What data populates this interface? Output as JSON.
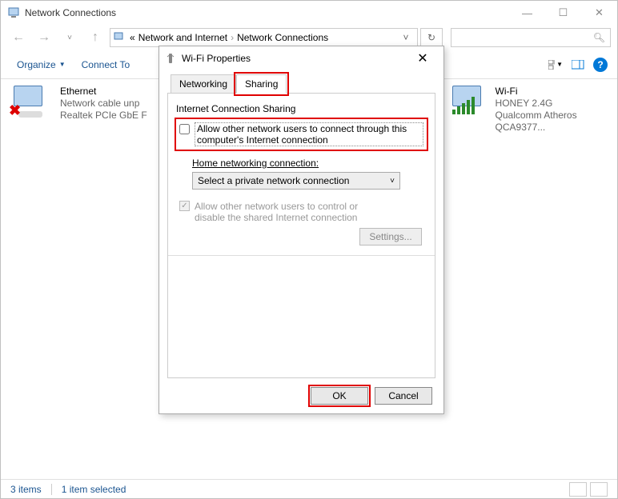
{
  "window": {
    "title": "Network Connections",
    "minimize": "—",
    "maximize": "☐",
    "close": "✕"
  },
  "breadcrumb": {
    "parent": "Network and Internet",
    "current": "Network Connections"
  },
  "toolbar": {
    "organize": "Organize",
    "connect_to": "Connect To"
  },
  "connections": [
    {
      "name": "Ethernet",
      "status": "Network cable unp",
      "adapter": "Realtek PCIe GbE F"
    },
    {
      "name": "Wi-Fi",
      "status": "HONEY 2.4G",
      "adapter": "Qualcomm Atheros QCA9377..."
    }
  ],
  "status": {
    "count": "3 items",
    "selected": "1 item selected"
  },
  "dialog": {
    "title": "Wi-Fi Properties",
    "tabs": {
      "networking": "Networking",
      "sharing": "Sharing"
    },
    "group": "Internet Connection Sharing",
    "allow_label": "Allow other network users to connect through this computer's Internet connection",
    "home_label_pre": "H",
    "home_label_u": "o",
    "home_label_post": "me networking connection:",
    "select_value": "Select a private network connection",
    "allow_control": "Allow other network users to control or disable the shared Internet connection",
    "settings": "Settings...",
    "ok": "OK",
    "cancel": "Cancel"
  }
}
